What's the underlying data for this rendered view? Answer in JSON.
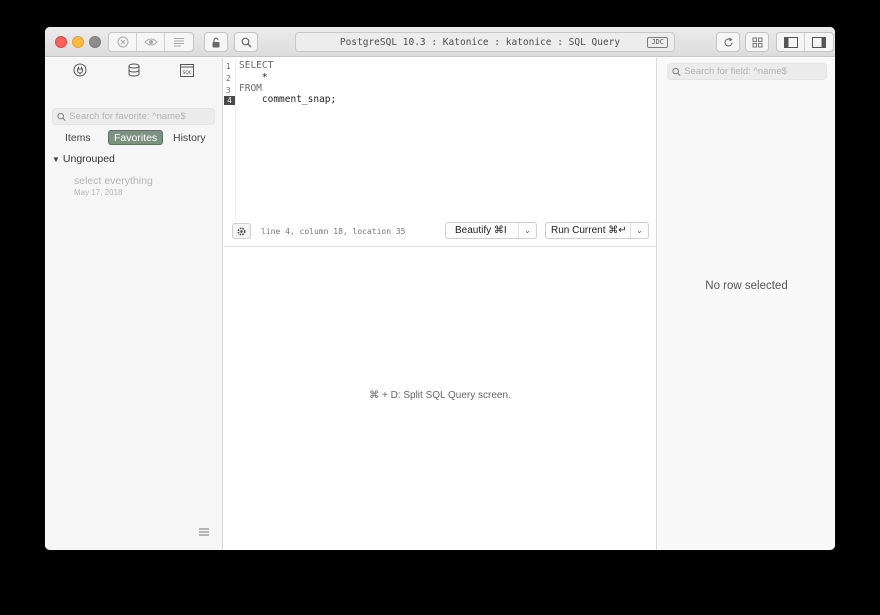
{
  "window": {
    "title": "PostgreSQL 10.3 : Katonice : katonice : SQL Query",
    "title_badge": "JDC"
  },
  "toolbar": {
    "icons": [
      "stop-icon",
      "preview-icon",
      "list-icon",
      "lock-icon",
      "search-icon",
      "refresh-icon",
      "grid-icon",
      "left-panel-icon",
      "right-panel-icon"
    ]
  },
  "sidebar": {
    "icons": [
      "connection-icon",
      "database-icon",
      "sql-icon"
    ],
    "search_placeholder": "Search for favorite: ^name$",
    "tabs": [
      {
        "label": "Items",
        "active": false
      },
      {
        "label": "Favorites",
        "active": true
      },
      {
        "label": "History",
        "active": false
      }
    ],
    "group": "Ungrouped",
    "favorites": [
      {
        "title": "select everything",
        "date": "May 17, 2018"
      }
    ]
  },
  "editor": {
    "lines": [
      {
        "number": "1",
        "text": "SELECT"
      },
      {
        "number": "2",
        "text": "    *"
      },
      {
        "number": "3",
        "text": "FROM"
      },
      {
        "number": "4",
        "text": "    comment_snap;"
      }
    ],
    "current_line": "4",
    "status": "line 4, column 18, location 35",
    "beautify_label": "Beautify ⌘I",
    "run_label": "Run Current ⌘↵"
  },
  "results": {
    "hint": "⌘ + D: Split SQL Query screen."
  },
  "right_panel": {
    "search_placeholder": "Search for field: ^name$",
    "empty_text": "No row selected"
  },
  "colors": {
    "close": "#fc605c",
    "minimize": "#fcbb40",
    "maximize": "#8c8c8c",
    "active_tab": "#7c9180"
  }
}
